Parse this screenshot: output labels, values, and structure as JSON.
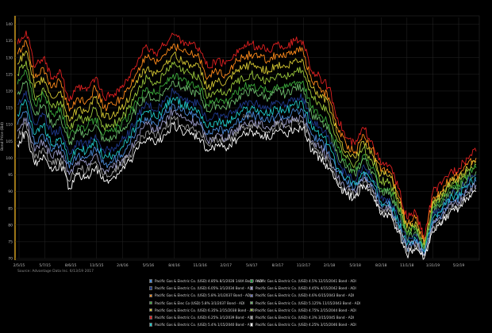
{
  "chart_data": {
    "type": "line",
    "title": "",
    "xlabel": "Date",
    "ylabel": "Bond Price (Bid)",
    "ylim": [
      70,
      142
    ],
    "yticks": [
      70,
      75,
      80,
      85,
      90,
      95,
      100,
      105,
      110,
      115,
      120,
      125,
      130,
      135,
      140
    ],
    "xticks": [
      "2/5/15",
      "5/7/15",
      "8/6/15",
      "11/5/15",
      "2/4/16",
      "5/5/16",
      "8/4/16",
      "11/3/16",
      "2/2/17",
      "5/4/17",
      "8/3/17",
      "11/2/17",
      "2/1/18",
      "5/3/18",
      "8/2/18",
      "11/1/18",
      "1/31/19",
      "5/2/19"
    ],
    "x": [
      "2/5/15",
      "3/7/15",
      "4/6/15",
      "5/7/15",
      "6/6/15",
      "7/6/15",
      "8/6/15",
      "9/5/15",
      "10/5/15",
      "11/5/15",
      "12/5/15",
      "1/4/16",
      "2/4/16",
      "3/5/16",
      "4/4/16",
      "5/5/16",
      "6/4/16",
      "7/4/16",
      "8/4/16",
      "9/3/16",
      "10/3/16",
      "11/3/16",
      "12/3/16",
      "1/2/17",
      "2/2/17",
      "3/4/17",
      "4/3/17",
      "5/4/17",
      "6/3/17",
      "7/3/17",
      "8/3/17",
      "9/2/17",
      "10/2/17",
      "11/2/17",
      "12/2/17",
      "1/1/18",
      "2/1/18",
      "3/3/18",
      "4/2/18",
      "5/3/18",
      "6/2/18",
      "7/2/18",
      "8/2/18",
      "9/1/18",
      "10/1/18",
      "11/1/18",
      "12/1/18",
      "12/31/18",
      "1/31/19",
      "3/2/19",
      "4/1/19",
      "5/2/19",
      "6/1/19",
      "6/13/19"
    ],
    "grid": true,
    "legend_position": "bottom",
    "series": [
      {
        "name": "Pacific Gas & Electric Co. (USD) 4.60% 6/15/2043 Bond - ADI",
        "color": "#e02020",
        "values": [
          134,
          138,
          127,
          130,
          124,
          126,
          117,
          121,
          120,
          124,
          118,
          119,
          121,
          124,
          130,
          133,
          131,
          134,
          137,
          135,
          134,
          133,
          127,
          129,
          128,
          131,
          133,
          134,
          133,
          132,
          134,
          133,
          135,
          135,
          126,
          124,
          121,
          112,
          106,
          104,
          109,
          105,
          98,
          98,
          91,
          82,
          84,
          76,
          90,
          92,
          96,
          97,
          100,
          102
        ]
      },
      {
        "name": "Pacific Gas & Electric Co. (USD) 5.4% 1/15/2040 Bond - ADI",
        "color": "#ff8a1a",
        "values": [
          131,
          135,
          124,
          127,
          121,
          123,
          114,
          118,
          117,
          121,
          115,
          116,
          118,
          121,
          127,
          130,
          128,
          131,
          134,
          132,
          131,
          130,
          124,
          126,
          125,
          128,
          130,
          131,
          130,
          129,
          131,
          130,
          132,
          132,
          123,
          121,
          118,
          109,
          104,
          102,
          107,
          103,
          96,
          96,
          89,
          80,
          82,
          75,
          88,
          90,
          94,
          95,
          98,
          100
        ]
      },
      {
        "name": "Pacific Gas & Electric Co. (USD) 6.25% 3/1/2039 Bond - ADI",
        "color": "#d6c832",
        "values": [
          128,
          132,
          121,
          124,
          118,
          120,
          111,
          115,
          114,
          118,
          112,
          113,
          115,
          118,
          124,
          127,
          125,
          128,
          131,
          129,
          128,
          127,
          121,
          123,
          122,
          125,
          127,
          128,
          127,
          126,
          128,
          127,
          129,
          129,
          121,
          119,
          116,
          107,
          102,
          100,
          105,
          101,
          95,
          95,
          88,
          79,
          81,
          74,
          87,
          89,
          93,
          94,
          97,
          99
        ]
      },
      {
        "name": "Pacific Gas & Electric Co. (USD) 6.35% 2/15/2038 Bond - ADI",
        "color": "#9ac83a",
        "values": [
          125,
          129,
          118,
          121,
          115,
          117,
          109,
          112,
          111,
          115,
          109,
          110,
          112,
          115,
          121,
          124,
          122,
          125,
          128,
          126,
          125,
          124,
          118,
          120,
          119,
          122,
          124,
          125,
          124,
          123,
          125,
          124,
          126,
          126,
          118,
          116,
          113,
          105,
          100,
          98,
          103,
          99,
          93,
          93,
          86,
          78,
          80,
          73,
          86,
          88,
          92,
          93,
          96,
          98
        ]
      },
      {
        "name": "Pacific Gas & Elec Co (USD) 5.8% 3/1/2037 Bond - ADI",
        "color": "#3aa83a",
        "values": [
          122,
          126,
          116,
          119,
          113,
          115,
          106,
          110,
          109,
          112,
          107,
          108,
          110,
          113,
          118,
          121,
          119,
          122,
          125,
          123,
          122,
          121,
          116,
          118,
          117,
          119,
          121,
          122,
          121,
          120,
          122,
          121,
          123,
          123,
          115,
          113,
          110,
          103,
          98,
          96,
          101,
          97,
          91,
          91,
          85,
          77,
          79,
          73,
          85,
          87,
          91,
          92,
          95,
          97
        ]
      },
      {
        "name": "Pacific Gas & Electric Co. (USD) 4.75% 2/15/2044 Bond - ADI",
        "color": "#6ab86a",
        "values": [
          119,
          123,
          113,
          116,
          110,
          112,
          104,
          108,
          107,
          110,
          105,
          106,
          108,
          111,
          116,
          119,
          117,
          120,
          123,
          121,
          120,
          119,
          114,
          116,
          115,
          117,
          119,
          120,
          119,
          118,
          120,
          119,
          121,
          121,
          113,
          111,
          108,
          101,
          97,
          95,
          100,
          96,
          90,
          90,
          84,
          76,
          78,
          72,
          84,
          86,
          90,
          91,
          94,
          96
        ]
      },
      {
        "name": "Pacific Gas & Electric Co. (USD) 6.05% 3/1/2034 Bond - ADI",
        "color": "#1e3a8c",
        "values": [
          116,
          120,
          110,
          113,
          107,
          109,
          101,
          105,
          104,
          107,
          102,
          103,
          105,
          108,
          113,
          116,
          114,
          117,
          120,
          118,
          117,
          116,
          111,
          113,
          112,
          114,
          116,
          117,
          116,
          115,
          117,
          116,
          118,
          118,
          111,
          109,
          106,
          99,
          95,
          93,
          98,
          94,
          88,
          88,
          82,
          75,
          77,
          72,
          83,
          85,
          89,
          90,
          93,
          95
        ]
      },
      {
        "name": "Pacific Gas & Electric Co. (USD) 4.25% 3/15/2046 Bond - ADI",
        "color": "#20c8c8",
        "values": [
          113,
          117,
          107,
          110,
          104,
          106,
          99,
          103,
          102,
          105,
          100,
          101,
          103,
          106,
          111,
          114,
          112,
          115,
          118,
          116,
          115,
          114,
          109,
          111,
          110,
          112,
          114,
          115,
          114,
          113,
          115,
          114,
          116,
          116,
          109,
          107,
          104,
          97,
          94,
          92,
          96,
          93,
          87,
          87,
          81,
          74,
          76,
          72,
          82,
          84,
          88,
          89,
          92,
          94
        ]
      },
      {
        "name": "Pacific Gas & Electric Co. (USD) 4.85% 8/1/2028 144A Bond - ADI",
        "color": "#4a8ad8",
        "values": [
          110,
          114,
          104,
          107,
          102,
          104,
          97,
          101,
          100,
          103,
          98,
          99,
          101,
          104,
          109,
          112,
          110,
          113,
          116,
          114,
          113,
          112,
          107,
          109,
          108,
          110,
          112,
          113,
          112,
          111,
          113,
          112,
          114,
          114,
          107,
          105,
          102,
          96,
          93,
          91,
          95,
          92,
          86,
          86,
          80,
          73,
          75,
          71,
          81,
          83,
          87,
          88,
          91,
          93
        ]
      },
      {
        "name": "Pacific Gas & Electric Co. (USD) 4.45% 4/15/2042 Bond - ADI",
        "color": "#9a9ac8",
        "values": [
          108,
          112,
          102,
          105,
          100,
          102,
          95,
          99,
          98,
          101,
          96,
          97,
          99,
          102,
          107,
          110,
          108,
          111,
          114,
          112,
          111,
          110,
          105,
          107,
          106,
          108,
          110,
          111,
          110,
          109,
          111,
          110,
          112,
          112,
          105,
          103,
          100,
          94,
          91,
          90,
          94,
          91,
          85,
          85,
          79,
          73,
          75,
          71,
          80,
          82,
          86,
          87,
          90,
          92
        ]
      },
      {
        "name": "Pacific Gas & Electric Co. (USD) 4.30% 3/15/2045 Bond - ADI",
        "color": "#a0a0a0",
        "values": [
          106,
          110,
          100,
          103,
          98,
          100,
          93,
          97,
          96,
          99,
          95,
          96,
          98,
          101,
          105,
          108,
          106,
          109,
          112,
          110,
          109,
          108,
          104,
          106,
          105,
          107,
          109,
          110,
          109,
          108,
          110,
          109,
          111,
          111,
          104,
          102,
          99,
          93,
          90,
          89,
          93,
          90,
          84,
          84,
          79,
          72,
          74,
          71,
          79,
          81,
          85,
          86,
          89,
          91
        ]
      },
      {
        "name": "Pacific Gas & Electric Co. (USD) 4.00% 12/1/2046 Bond - ADI",
        "color": "#ffffff",
        "values": [
          104,
          108,
          98,
          101,
          96,
          98,
          91,
          95,
          94,
          97,
          93,
          94,
          96,
          99,
          103,
          106,
          104,
          107,
          110,
          108,
          107,
          106,
          102,
          104,
          103,
          105,
          107,
          108,
          107,
          106,
          108,
          107,
          109,
          109,
          102,
          100,
          97,
          92,
          89,
          88,
          92,
          89,
          83,
          83,
          78,
          71,
          73,
          70,
          78,
          80,
          84,
          85,
          88,
          90
        ]
      }
    ]
  },
  "footer": {
    "source": "Source: Advantage Data Inc. 6/13/19 2017"
  },
  "legend": {
    "items": [
      {
        "label": "Pacific Gas & Electric Co. (USD) 4.85% 8/1/2028 144A Bond - ADI",
        "color": "#4a8ad8"
      },
      {
        "label": "Pacific Gas & Electric Co. (USD) 4.5% 12/15/2041 Bond - ADI",
        "color": "#2aa84a"
      },
      {
        "label": "Pacific Gas & Electric Co. (USD) 6.05% 3/1/2034 Bond - ADI",
        "color": "#1e3a8c"
      },
      {
        "label": "Pacific Gas & Electric Co. (USD) 4.45% 4/15/2042 Bond - ADI",
        "color": "#9a9ac8"
      },
      {
        "label": "Pacific Gas & Electric Co. (USD) 5.8% 3/1/2037 Bond - ADI",
        "color": "#ff8a1a"
      },
      {
        "label": "Pacific Gas & Electric Co. (USD) 4.6% 6/15/2043 Bond - ADI",
        "color": "#6a70c0"
      },
      {
        "label": "Pacific Gas & Elec Co (USD) 5.8% 3/1/2037 Bond - ADI",
        "color": "#3aa83a"
      },
      {
        "label": "Pacific Gas & Electric Co. (USD) 5.125% 11/15/2043 Bond - ADI",
        "color": "#6ab86a"
      },
      {
        "label": "Pacific Gas & Electric Co. (USD) 6.35% 2/15/2038 Bond - ADI",
        "color": "#d6c832"
      },
      {
        "label": "Pacific Gas & Electric Co. (USD) 4.75% 2/15/2044 Bond - ADI",
        "color": "#9ac83a"
      },
      {
        "label": "Pacific Gas & Electric Co. (USD) 6.25% 3/1/2039 Bond - ADI",
        "color": "#e02020"
      },
      {
        "label": "Pacific Gas & Electric Co. (USD) 4.3% 3/15/2045 Bond - ADI",
        "color": "#a0a0a0"
      },
      {
        "label": "Pacific Gas & Electric Co. (USD) 5.4% 1/15/2040 Bond - ADI",
        "color": "#20c8c8"
      },
      {
        "label": "Pacific Gas & Electric Co. (USD) 4.25% 3/15/2046 Bond - ADI",
        "color": "#ffffff"
      }
    ]
  }
}
